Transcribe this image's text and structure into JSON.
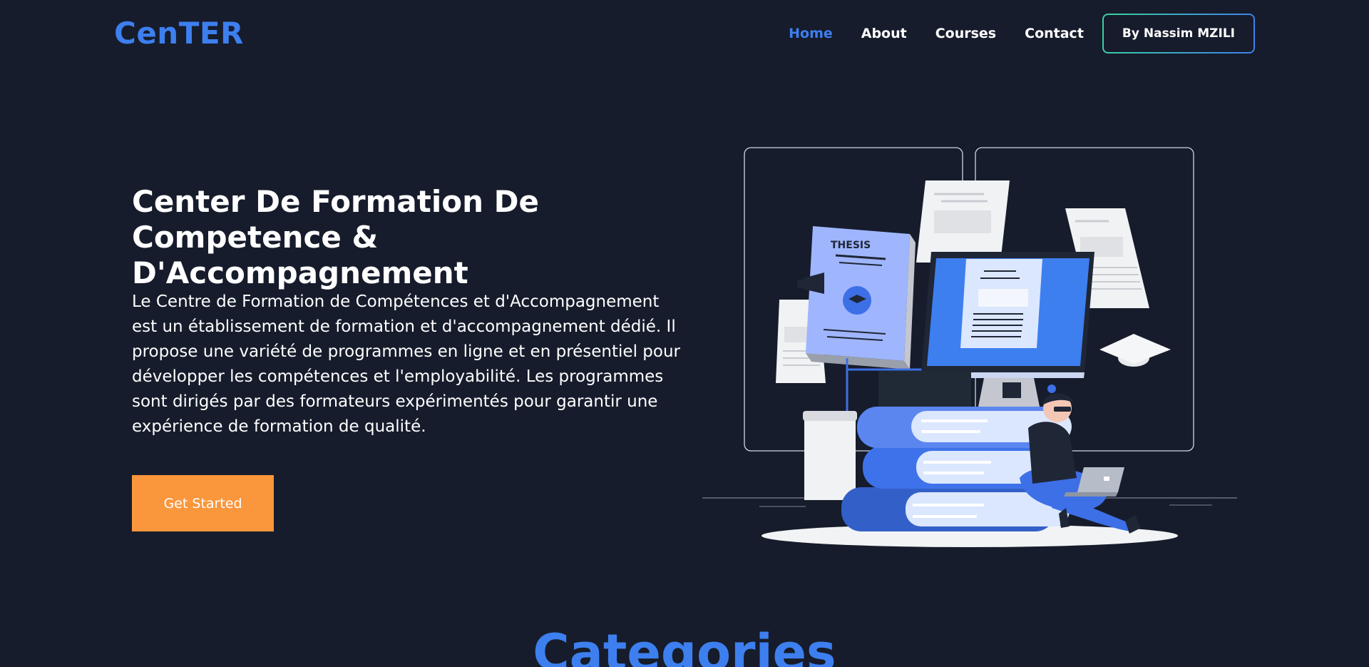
{
  "brand": {
    "logo": "CenTER"
  },
  "nav": {
    "items": [
      {
        "label": "Home",
        "active": true
      },
      {
        "label": "About",
        "active": false
      },
      {
        "label": "Courses",
        "active": false
      },
      {
        "label": "Contact",
        "active": false
      }
    ],
    "author_button": "By Nassim MZILI"
  },
  "hero": {
    "title_line1": "Center De Formation De",
    "title_line2": "Competence & D'Accompagnement",
    "description": "Le Centre de Formation de Compétences et d'Accompagnement est un établissement de formation et d'accompagnement dédié. Il propose une variété de programmes en ligne et en présentiel pour développer les compétences et l'employabilité. Les programmes sont dirigés par des formateurs expérimentés pour garantir une expérience de formation de qualité.",
    "cta_label": "Get Started"
  },
  "illustration": {
    "thesis_label": "THESIS"
  },
  "sections": {
    "categories_title": "Categories"
  },
  "colors": {
    "background": "#161c2b",
    "accent": "#3d7fef",
    "cta": "#fa963c"
  }
}
